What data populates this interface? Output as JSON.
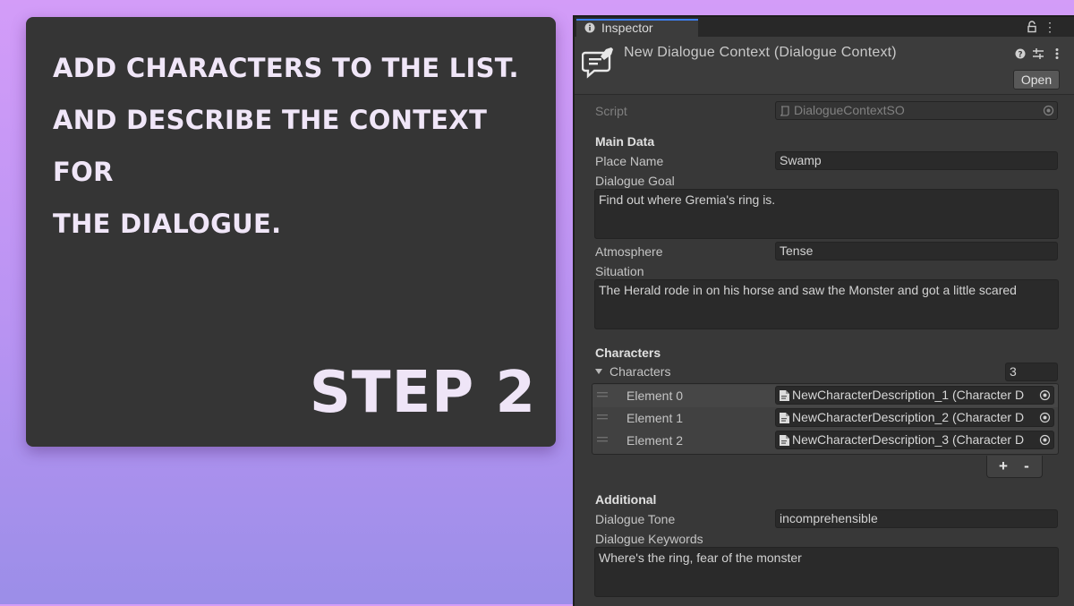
{
  "card": {
    "instruction_lines": [
      "ADD CHARACTERS TO THE LIST.",
      "AND DESCRIBE THE CONTEXT FOR",
      "THE DIALOGUE."
    ],
    "step": "STEP 2"
  },
  "inspector": {
    "tab_label": "Inspector",
    "title": "New Dialogue Context (Dialogue Context)",
    "open_button": "Open",
    "script_label": "Script",
    "script_value": "DialogueContextSO",
    "sections": {
      "main_data": "Main Data",
      "characters": "Characters",
      "additional": "Additional"
    },
    "place_name": {
      "label": "Place Name",
      "value": "Swamp"
    },
    "dialogue_goal": {
      "label": "Dialogue Goal",
      "value": "Find out where Gremia's ring is."
    },
    "atmosphere": {
      "label": "Atmosphere",
      "value": "Tense"
    },
    "situation": {
      "label": "Situation",
      "value": "The Herald rode in on his horse and saw the Monster and got a little scared"
    },
    "characters_list": {
      "label": "Characters",
      "count": "3",
      "elements": [
        {
          "label": "Element 0",
          "value": "NewCharacterDescription_1 (Character D"
        },
        {
          "label": "Element 1",
          "value": "NewCharacterDescription_2 (Character D"
        },
        {
          "label": "Element 2",
          "value": "NewCharacterDescription_3 (Character D"
        }
      ],
      "add_symbol": "+",
      "remove_symbol": "-"
    },
    "dialogue_tone": {
      "label": "Dialogue Tone",
      "value": "incomprehensible"
    },
    "dialogue_keywords": {
      "label": "Dialogue Keywords",
      "value": "Where's the ring, fear of the monster"
    }
  },
  "icons": [
    "info-icon",
    "lock-icon",
    "kebab-menu-icon",
    "dialogue-context-icon",
    "help-icon",
    "settings-sliders-icon",
    "script-icon",
    "object-picker-icon",
    "foldout-triangle-icon",
    "drag-handle-icon",
    "scriptable-object-icon"
  ],
  "colors": {
    "background_top": "#d39cf8",
    "background_bottom": "#9b8ee8",
    "card": "#353535",
    "inspector_bg": "#383838",
    "tab_accent": "#3d7ef0"
  }
}
